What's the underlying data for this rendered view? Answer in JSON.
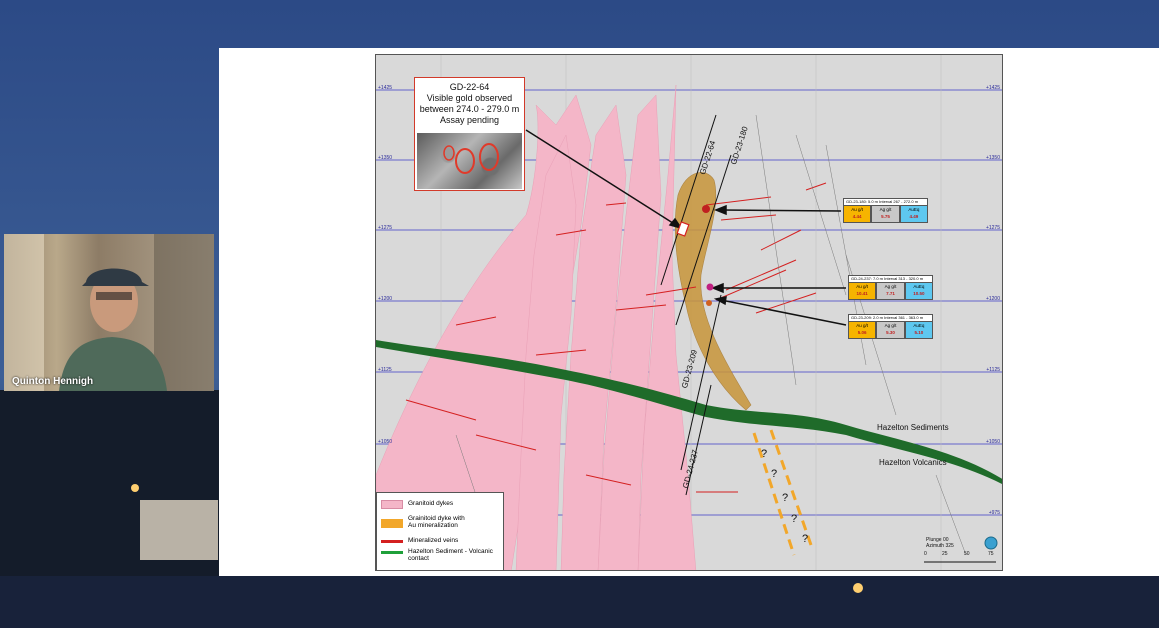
{
  "webcam": {
    "participant_name": "Quinton Hennigh"
  },
  "map": {
    "elevation_labels": [
      "+1425",
      "+1350",
      "+1275",
      "+1200",
      "+1125",
      "+1050",
      "+975"
    ],
    "callout": {
      "title": "GD-22-64",
      "line1": "Visible gold observed",
      "line2": "between 274.0 - 279.0 m",
      "line3": "Assay pending"
    },
    "drill_holes": [
      "GD-22-64",
      "GD-23-180",
      "GD-23-209",
      "GD-24-237"
    ],
    "assays": [
      {
        "header": "GD-23-180: 5.0 m Interval 267 - 272.0 m",
        "au_label": "Au g/t",
        "au": "4.44",
        "ag_label": "Ag g/t",
        "ag": "5.75",
        "aueq_label": "AuEq",
        "aueq": "4.49"
      },
      {
        "header": "GD-24-237: 7.0 m Interval 313 - 320.0 m",
        "au_label": "Au g/t",
        "au": "10.41",
        "ag_label": "Ag g/t",
        "ag": "7.71",
        "aueq_label": "AuEq",
        "aueq": "10.50"
      },
      {
        "header": "GD-23-209: 2.0 m Interval 361 - 363.0 m",
        "au_label": "Au g/t",
        "au": "5.06",
        "ag_label": "Ag g/t",
        "ag": "5.30",
        "aueq_label": "AuEq",
        "aueq": "5.10"
      }
    ],
    "units": {
      "sediments": "Hazelton Sediments",
      "volcanics": "Hazelton Volcanics"
    },
    "question_mark": "?",
    "legend": {
      "dykes": "Granitoid dykes",
      "au_dyke_1": "Grainitoid dyke with",
      "au_dyke_2": "Au mineralization",
      "veins": "Mineralized veins",
      "contact_1": "Hazelton Sediment - Volcanic",
      "contact_2": "contact"
    },
    "scale": {
      "plunge": "Plunge 00",
      "azimuth": "Azimuth 325",
      "ticks": [
        "0",
        "25",
        "50",
        "75"
      ]
    },
    "colors": {
      "dyke_pink": "#f4b6c8",
      "au_dyke": "#c8953a",
      "vein_red": "#d42020",
      "contact_green": "#1f6b2a",
      "elevation_line": "#3b3bc4"
    }
  }
}
